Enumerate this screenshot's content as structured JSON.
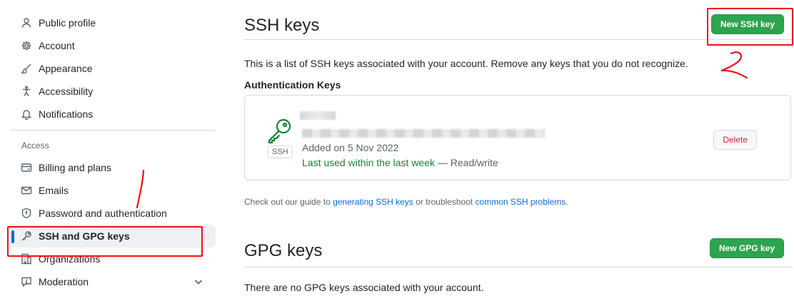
{
  "sidebar": {
    "items": [
      {
        "label": "Public profile",
        "icon": "person-icon"
      },
      {
        "label": "Account",
        "icon": "gear-icon"
      },
      {
        "label": "Appearance",
        "icon": "paintbrush-icon"
      },
      {
        "label": "Accessibility",
        "icon": "accessibility-icon"
      },
      {
        "label": "Notifications",
        "icon": "bell-icon"
      }
    ],
    "section_label": "Access",
    "access_items": [
      {
        "label": "Billing and plans",
        "icon": "credit-card-icon"
      },
      {
        "label": "Emails",
        "icon": "mail-icon"
      },
      {
        "label": "Password and authentication",
        "icon": "shield-lock-icon"
      },
      {
        "label": "SSH and GPG keys",
        "icon": "key-icon",
        "active": true
      },
      {
        "label": "Organizations",
        "icon": "organization-icon"
      },
      {
        "label": "Moderation",
        "icon": "report-icon"
      }
    ]
  },
  "ssh": {
    "title": "SSH keys",
    "new_button": "New SSH key",
    "description": "This is a list of SSH keys associated with your account. Remove any keys that you do not recognize.",
    "auth_heading": "Authentication Keys",
    "key": {
      "badge": "SSH",
      "added": "Added on 5 Nov 2022",
      "last_used": "Last used within the last week",
      "access": " — Read/write",
      "delete_button": "Delete"
    },
    "guide": {
      "prefix": "Check out our guide to ",
      "link1": "generating SSH keys",
      "middle": " or troubleshoot ",
      "link2": "common SSH problems",
      "suffix": "."
    }
  },
  "gpg": {
    "title": "GPG keys",
    "new_button": "New GPG key",
    "empty": "There are no GPG keys associated with your account."
  },
  "colors": {
    "accent": "#0969da",
    "green_button": "#2da44e",
    "annotation": "#ee1111",
    "danger": "#d1242f"
  }
}
